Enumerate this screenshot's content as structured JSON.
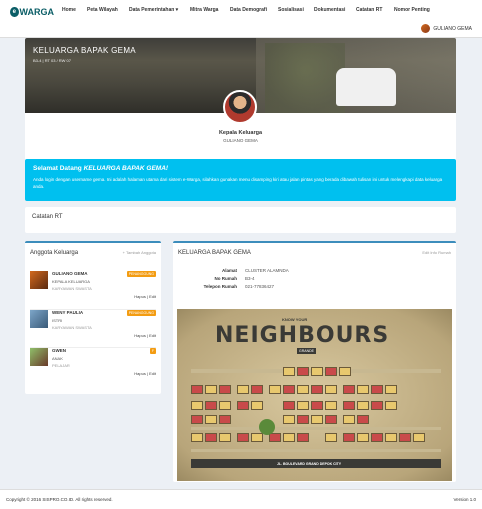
{
  "nav": {
    "logo_letter": "e",
    "logo_text": "WARGA",
    "items": [
      {
        "label": "Home"
      },
      {
        "label": "Peta Wilayah"
      },
      {
        "label": "Data Pemerintahan ▾"
      },
      {
        "label": "Mitra Warga"
      },
      {
        "label": "Data Demografi"
      },
      {
        "label": "Sosialisasi"
      },
      {
        "label": "Dokumentasi"
      },
      {
        "label": "Catatan RT"
      },
      {
        "label": "Nomor Penting"
      }
    ],
    "user_name": "GULIANO GEMA"
  },
  "cover": {
    "title": "KELUARGA BAPAK GEMA",
    "subtitle": "B3-4 | RT 03 / RW 07",
    "role": "Kepala Keluarga",
    "name": "GULIANO GEMA"
  },
  "welcome": {
    "title_prefix": "Selamat Datang ",
    "title_family": "KELUARGA BAPAK GEMA!",
    "body": "Anda login dengan username gema. Ini adalah halaman utama dari sistem e-Warga, silahkan gunakan menu disamping kiri atau jalan pintas yang berada dibawah tulisan ini untuk melengkapi data keluarga anda."
  },
  "catatan": {
    "title": "Catatan RT"
  },
  "anggota": {
    "title": "Anggota Keluarga",
    "add_label": "+ Tambah Anggota",
    "hapus_label": "Hapus",
    "edit_label": "Edit",
    "members": [
      {
        "name": "GULIANO GEMA",
        "relation": "KEPALA KELUARGA",
        "job": "KARYAWAN SWASTA",
        "badge": "PENANGGUNG"
      },
      {
        "name": "WENY PAULIA",
        "relation": "ISTRI",
        "job": "KARYAWAN SWASTA",
        "badge": "PENANGGUNG"
      },
      {
        "name": "GWEN",
        "relation": "ANAK",
        "job": "PELAJAR",
        "badge": "F"
      }
    ]
  },
  "info": {
    "title": "KELUARGA BAPAK GEMA",
    "edit_label": "Edit Info Rumah",
    "rows": [
      {
        "label": "Alamat",
        "value": "CLUSTER ALAMNDA"
      },
      {
        "label": "No Rumah",
        "value": "B3-4"
      },
      {
        "label": "Telepon Rumah",
        "value": "021-77836427"
      }
    ],
    "map": {
      "know": "KNOW YOUR",
      "title": "NEIGHBOURS",
      "badge": "GRANDE",
      "tagline": "JL. BOULEVARD GRAND DEPOK CITY"
    }
  },
  "footer": {
    "copyright": "Copyright © 2016 SISPRO.CO.ID. All rights reserved.",
    "version": "Version 1.0"
  }
}
